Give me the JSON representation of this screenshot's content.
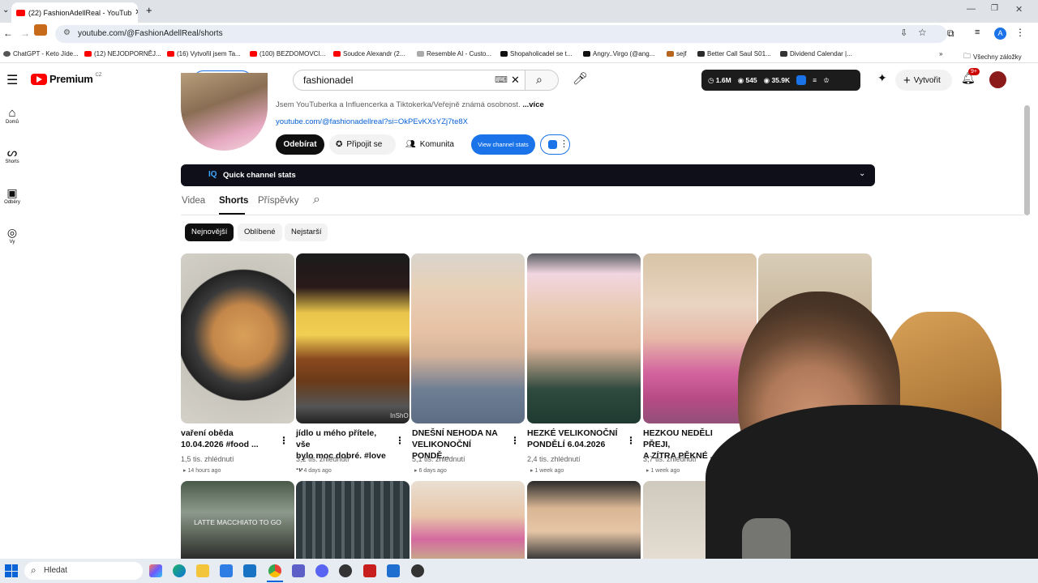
{
  "browser": {
    "tab_title": "(22) FashionAdellReal - YouTub",
    "url": "youtube.com/@FashionAdellReal/shorts",
    "profile_initial": "A",
    "bookmarks": [
      "ChatGPT - Keto Jíde...",
      "(12) NEJODPORNĚJ...",
      "(16) Vytvořil jsem Ta...",
      "(100) BEZDOMOVCI...",
      "Soudce Alexandr (2...",
      "Resemble AI - Custo...",
      "Shopaholicadel se t...",
      "Angry..Virgo (@ang...",
      "sejf",
      "Better Call Saul S01...",
      "Dividend Calendar |..."
    ],
    "all_bookmarks": "Všechny záložky"
  },
  "youtube": {
    "logo_text": "Premium",
    "logo_region": "CZ",
    "search_value": "fashionadel",
    "vidiq_stats": {
      "views": "1.6M",
      "videos": "545",
      "subs": "35.9K"
    },
    "create_label": "Vytvořit",
    "notif_count": "9+",
    "sidebar": [
      {
        "label": "Domů",
        "icon": "home-icon"
      },
      {
        "label": "Shorts",
        "icon": "shorts-icon"
      },
      {
        "label": "Odběry",
        "icon": "subscriptions-icon"
      },
      {
        "label": "Vy",
        "icon": "profile-icon"
      }
    ]
  },
  "channel": {
    "description": "Jsem YouTuberka a Influencerka a Tiktokerka/Veřejně známá osobnost.",
    "more_label": "...více",
    "link": "youtube.com/@fashionadellreal?si=OkPEvKXsYZj7te8X",
    "subscribe_label": "Odebírat",
    "join_label": "Připojit se",
    "community_label": "Komunita",
    "vidiq_button": "View channel stats",
    "quick_stats_label": "Quick channel stats",
    "tabs": [
      "Videa",
      "Shorts",
      "Příspěvky"
    ],
    "active_tab": "Shorts",
    "filters": [
      "Nejnovější",
      "Oblíbené",
      "Nejstarší"
    ],
    "active_filter": "Nejnovější"
  },
  "shorts": [
    {
      "title_l1": "vaření oběda",
      "title_l2": "10.04.2026 #food ...",
      "views": "1,5 tis. zhlédnutí",
      "time": "14 hours ago"
    },
    {
      "title_l1": "jídlo u mého přítele, vše",
      "title_l2": "bylo moc dobré. #love ...",
      "views": "3,2 tis. zhlédnutí",
      "time": "4 days ago"
    },
    {
      "title_l1": "DNEŠNÍ NEHODA NA",
      "title_l2": "VELIKONOČNÍ PONDĚ...",
      "views": "5,1 tis. zhlédnutí",
      "time": "6 days ago"
    },
    {
      "title_l1": "HEZKÉ VELIKONOČNÍ",
      "title_l2": "PONDĚLÍ 6.04.2026",
      "views": "2,4 tis. zhlédnutí",
      "time": "1 week ago"
    },
    {
      "title_l1": "HEZKOU NEDĚLI PŘEJI,",
      "title_l2": "A ZÍTRA PĚKNÉ ...",
      "views": "3,7 tis. zhlédnutí",
      "time": "1 week ago"
    }
  ],
  "thumb_texts": {
    "latte": "LATTE MACCHIATO TO GO",
    "inshot": "InShO"
  },
  "taskbar": {
    "search_placeholder": "Hledat"
  }
}
